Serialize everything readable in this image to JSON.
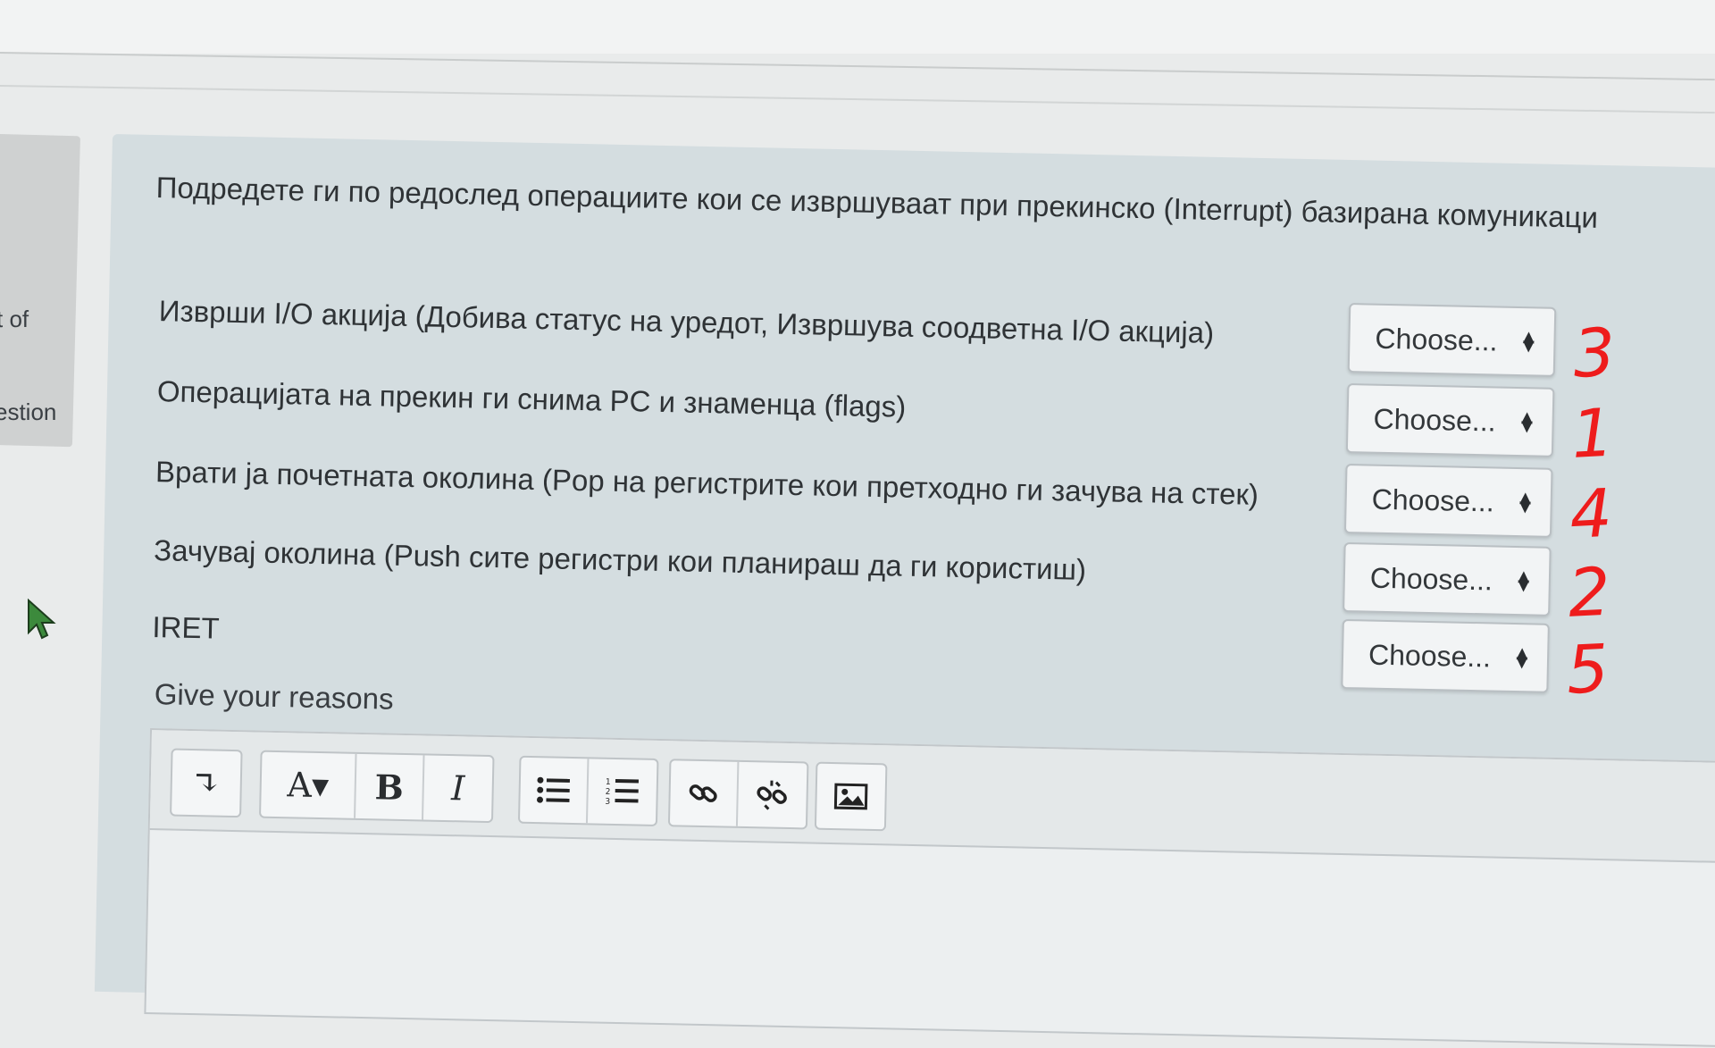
{
  "nav": {
    "partial_text_1": "t of",
    "partial_text_2": "estion"
  },
  "question": {
    "text": "Подредете ги по редослед операциите кои се извршуваат при прекинско (Interrupt) базирана комуникаци",
    "items": [
      {
        "stem": "Изврши I/O акција (Добива статус на уредот, Извршува соодветна I/O акција)",
        "select": "Choose...",
        "annotation": "3"
      },
      {
        "stem": "Операцијата на прекин ги снима PC и знаменца (flags)",
        "select": "Choose...",
        "annotation": "1"
      },
      {
        "stem": "Врати ја почетната околина (Pop на регистрите кои претходно ги зачува на стек)",
        "select": "Choose...",
        "annotation": "4"
      },
      {
        "stem": "Зачувај околина (Push сите регистри кои планираш да ги користиш)",
        "select": "Choose...",
        "annotation": "2"
      },
      {
        "stem": "IRET",
        "select": "Choose...",
        "annotation": "5"
      }
    ],
    "reasons_label": "Give your reasons"
  },
  "toolbar": {
    "collapse": "↴",
    "font_color": "A▾",
    "bold": "B",
    "italic": "I"
  },
  "colors": {
    "annotation_red": "#ee1c1c",
    "card_bg": "#d4dde0"
  }
}
